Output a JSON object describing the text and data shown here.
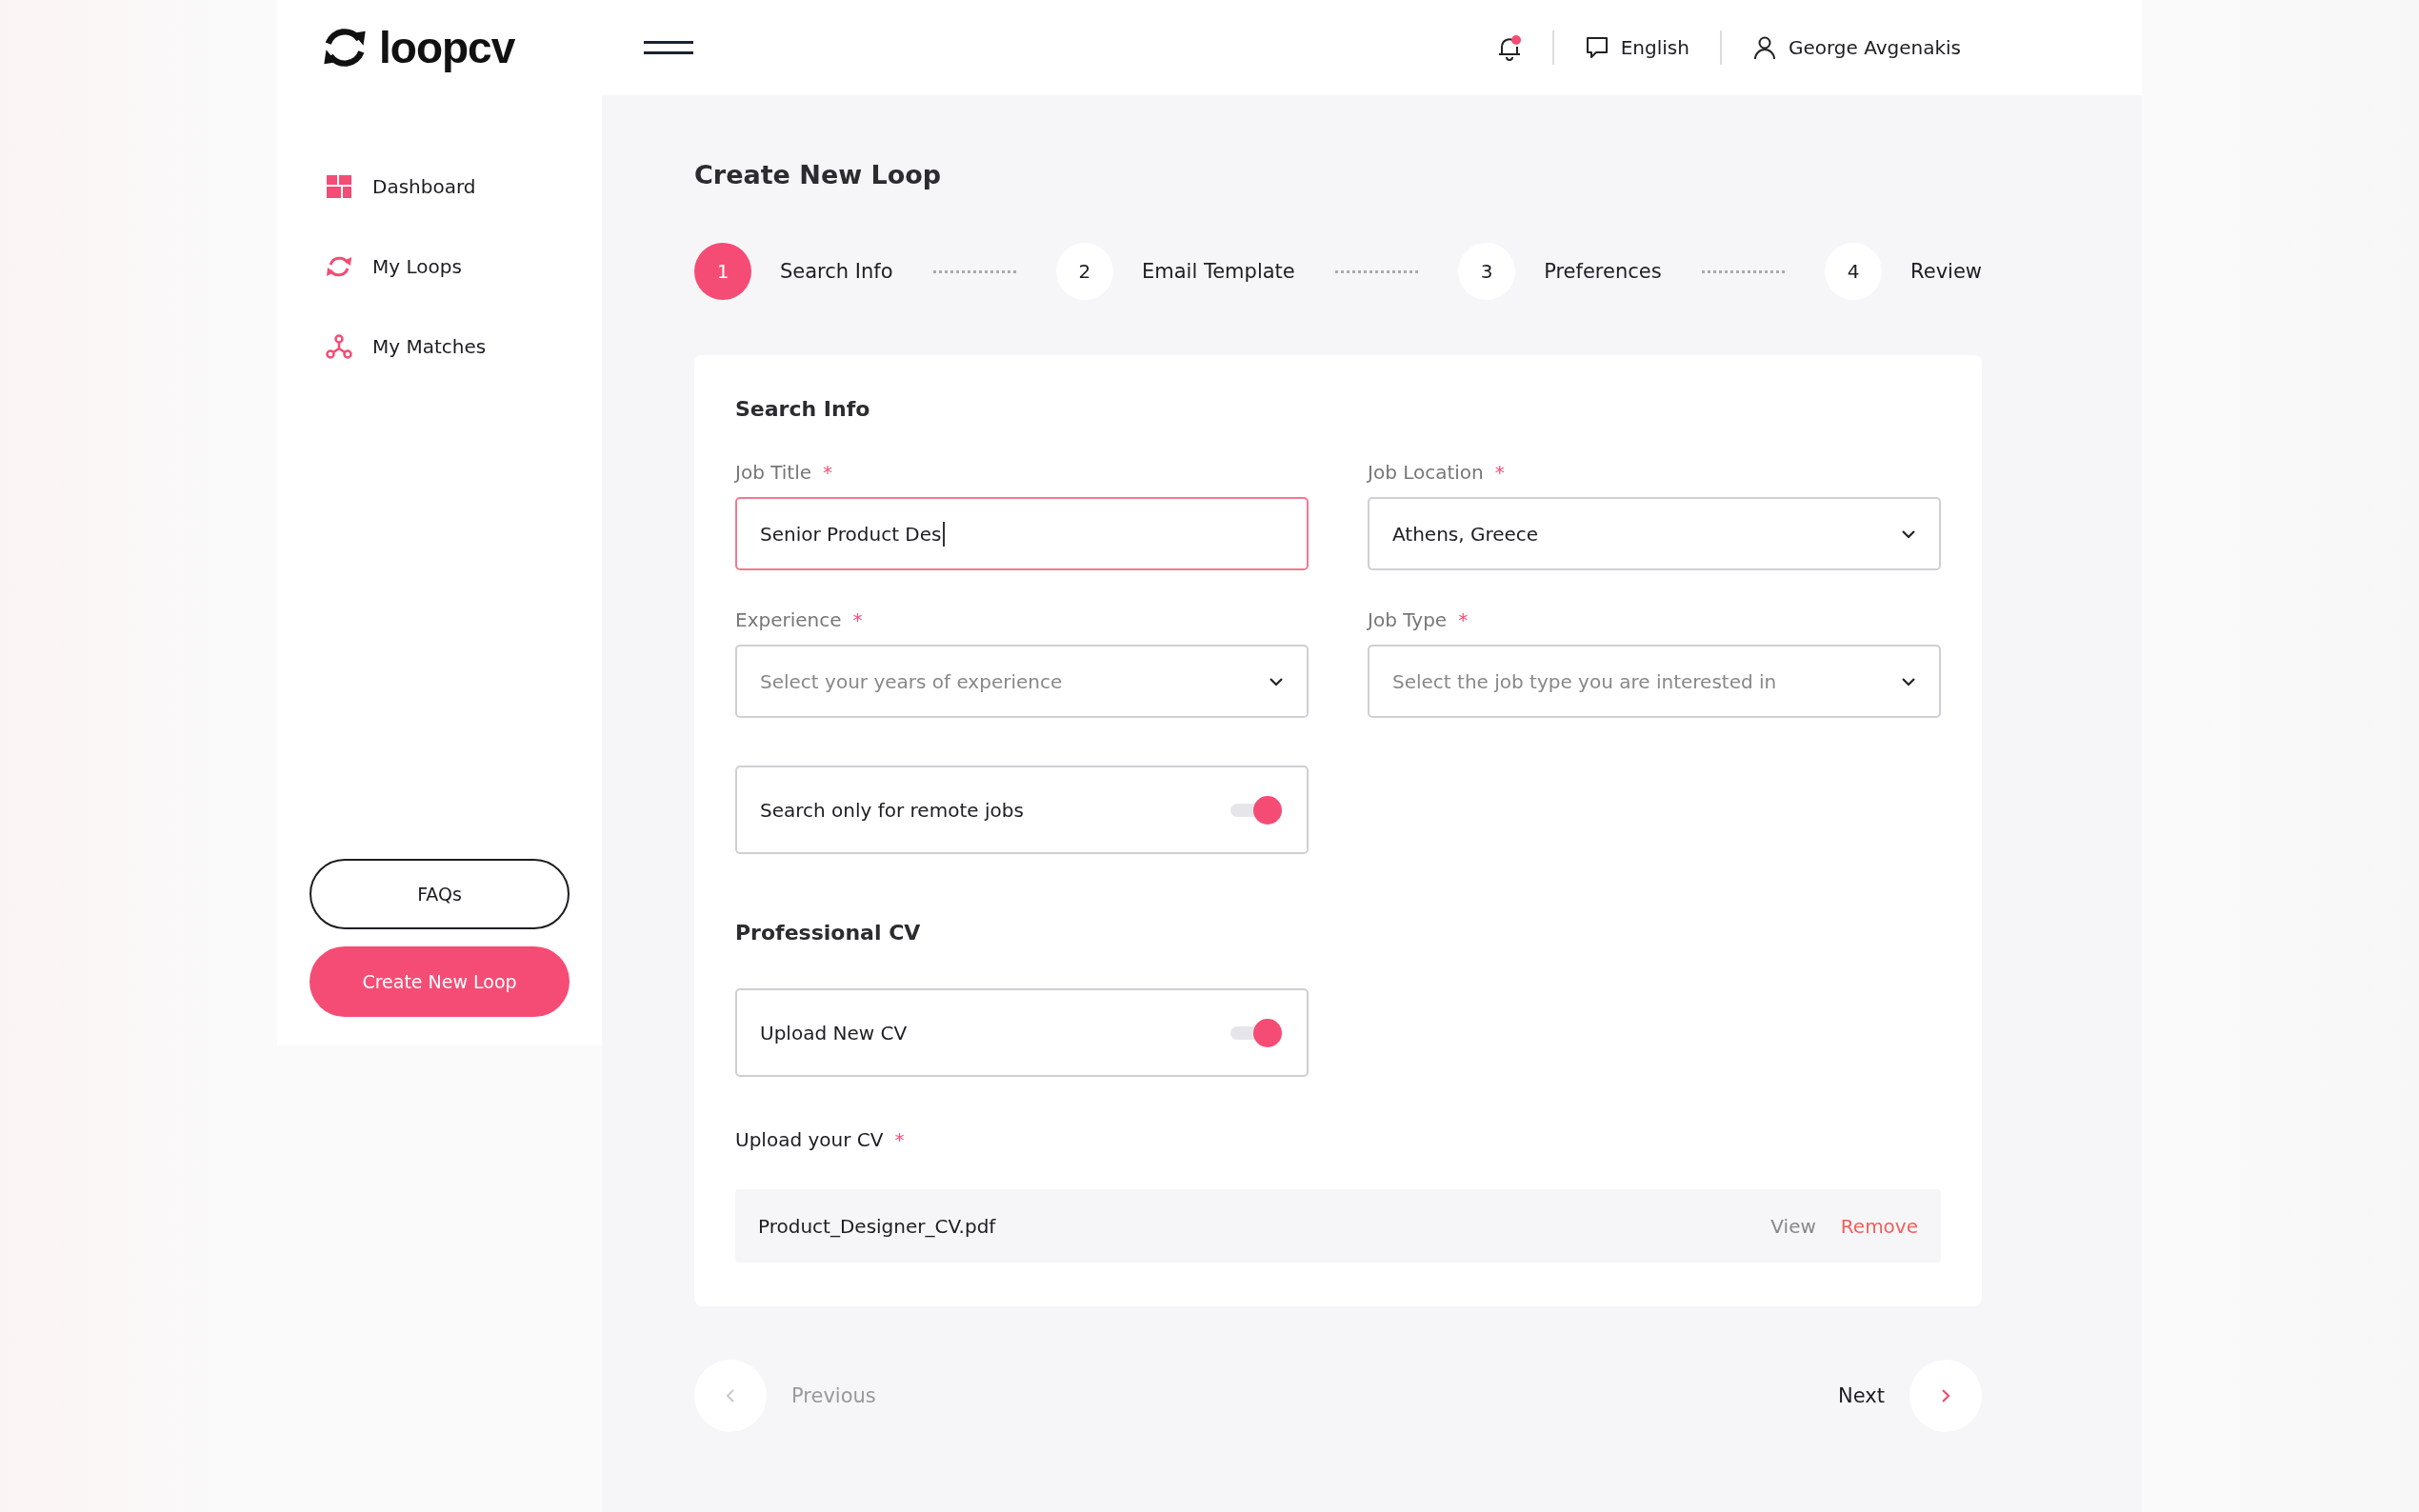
{
  "header": {
    "logo": "loopcv",
    "notifications": {
      "unread": true
    },
    "language": "English",
    "user": "George Avgenakis"
  },
  "sidebar": {
    "items": [
      {
        "label": "Dashboard"
      },
      {
        "label": "My Loops"
      },
      {
        "label": "My Matches"
      }
    ],
    "buttons": [
      {
        "label": "FAQs",
        "kind": "outline"
      },
      {
        "label": "Create New Loop",
        "kind": "primary"
      }
    ]
  },
  "page_title": "Create New Loop",
  "steps": [
    {
      "number": "1",
      "label": "Search Info",
      "selected": true
    },
    {
      "number": "2",
      "label": "Email Template",
      "selected": false
    },
    {
      "number": "3",
      "label": "Preferences",
      "selected": false
    },
    {
      "number": "4",
      "label": "Review",
      "selected": false
    }
  ],
  "card": {
    "title": "Search Info",
    "fields": [
      {
        "kind": "text",
        "label": "Job Title",
        "asterisk": "*",
        "value": "Senior Product Des",
        "focused": true
      },
      {
        "kind": "select",
        "label": "Job Location",
        "asterisk": "*",
        "value": "Athens, Greece"
      },
      {
        "kind": "select",
        "label": "Experience",
        "asterisk": "*",
        "placeholder": "Select your years of experience"
      },
      {
        "kind": "select",
        "label": "Job Type",
        "asterisk": "*",
        "placeholder": "Select the job type you are interested in"
      }
    ],
    "remote_toggle": {
      "label": "Search only for remote jobs",
      "on": true
    },
    "cv_heading": "Professional CV",
    "cv_toggle": {
      "label": "Upload New CV",
      "on": true
    },
    "upload_label": "Upload your CV",
    "upload_asterisk": "*",
    "file": {
      "name": "Product_Designer_CV.pdf",
      "view": "View",
      "remove": "Remove"
    }
  },
  "footer": {
    "previous": {
      "label": "Previous",
      "disabled": true
    },
    "next": {
      "label": "Next",
      "disabled": false
    }
  }
}
